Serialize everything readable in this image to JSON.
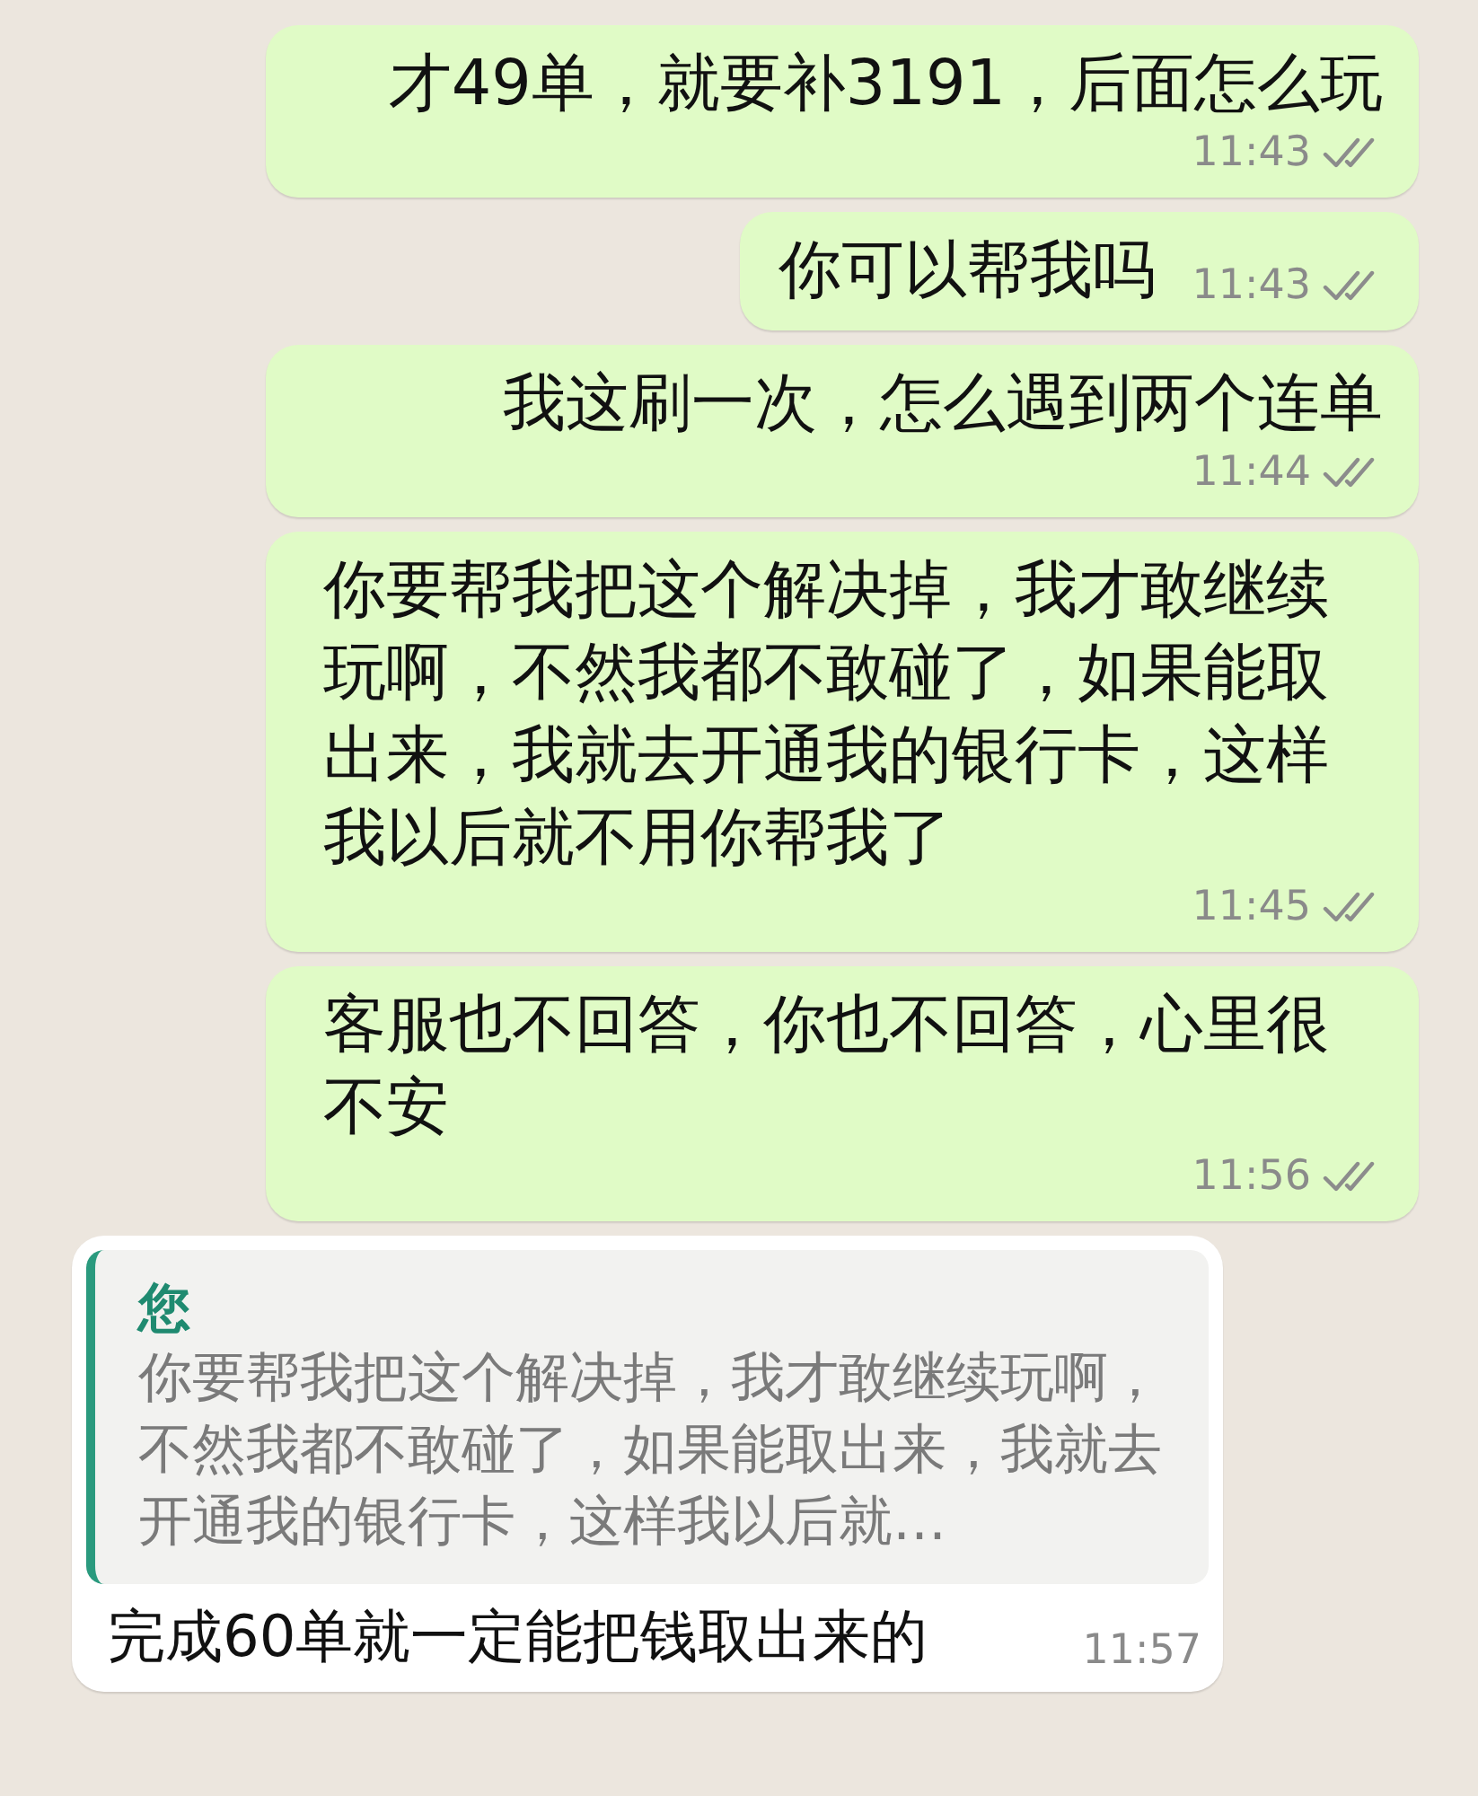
{
  "messages": [
    {
      "kind": "outgoing",
      "text": "才49单，就要补3191，后面怎么玩",
      "time": "11:43",
      "read": false
    },
    {
      "kind": "outgoing",
      "text": "你可以帮我吗",
      "time": "11:43",
      "read": false
    },
    {
      "kind": "outgoing",
      "text": "我这刷一次，怎么遇到两个连单",
      "time": "11:44",
      "read": false
    },
    {
      "kind": "outgoing",
      "text": "你要帮我把这个解决掉，我才敢继续玩啊，不然我都不敢碰了，如果能取出来，我就去开通我的银行卡，这样我以后就不用你帮我了",
      "time": "11:45",
      "read": false
    },
    {
      "kind": "outgoing",
      "text": "客服也不回答，你也不回答，心里很不安",
      "time": "11:56",
      "read": false
    },
    {
      "kind": "incoming",
      "quote": {
        "author": "您",
        "text": "你要帮我把这个解决掉，我才敢继续玩啊，不然我都不敢碰了，如果能取出来，我就去开通我的银行卡，这样我以后就…"
      },
      "text": "完成60单就一定能把钱取出来的",
      "time": "11:57"
    }
  ]
}
